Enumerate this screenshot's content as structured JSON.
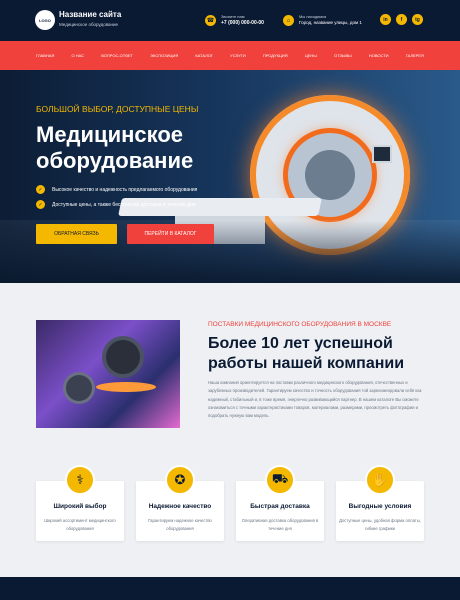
{
  "header": {
    "logo": "LOGO",
    "site_title": "Название сайта",
    "site_subtitle": "Медицинское оборудование",
    "phone_label": "Звоните нам",
    "phone": "+7 (000) 000-00-00",
    "address_label": "Мы находимся",
    "address": "Город, название улицы, дом 1",
    "social": [
      "in",
      "f",
      "tg"
    ]
  },
  "nav": {
    "items": [
      "Главная",
      "О нас",
      "Вопрос-ответ",
      "Экспозиция",
      "Каталог",
      "Услуги",
      "Продукция",
      "Цены",
      "Отзывы",
      "Новости",
      "Галерея"
    ]
  },
  "hero": {
    "kicker": "Большой выбор, доступные цены",
    "title": "Медицинское оборудование",
    "bullets": [
      "Высокое качество и надежность предлагаемого оборудования",
      "Доступные цены, а также бесплатная доставка в течение дня"
    ],
    "btn_feedback": "Обратная связь",
    "btn_catalog": "Перейти в каталог"
  },
  "about": {
    "kicker": "Поставки медицинского оборудования в Москве",
    "title": "Более 10 лет успешной работы нашей компании",
    "text": "Наша компания ориентируется на поставки различного медицинского оборудования, отечественных и зарубежных производителей. Гарантируем качество и точность оборудования той зарекомендовали себя как надежный, стабильный и, в тоже время, энергично развивающийся партнер. В нашем каталоге Вы сможете ознакомиться с точными характеристиками товаров, материалами, размерами, просмотреть фотографии и подобрать нужную вам модель."
  },
  "features": [
    {
      "title": "Широкий выбор",
      "text": "Широкий ассортимент медицинского оборудования",
      "icon": "microscope-icon"
    },
    {
      "title": "Надежное качество",
      "text": "Гарантируем надежное качество оборудования",
      "icon": "award-icon"
    },
    {
      "title": "Быстрая доставка",
      "text": "Оперативная доставка оборудования в течение дня",
      "icon": "delivery-icon"
    },
    {
      "title": "Выгодные условия",
      "text": "Доступные цены, удобная форма оплаты, гибкие графики",
      "icon": "deal-icon"
    }
  ],
  "colors": {
    "navy": "#0b1a33",
    "accent_red": "#f0413c",
    "accent_yellow": "#f5b800"
  }
}
